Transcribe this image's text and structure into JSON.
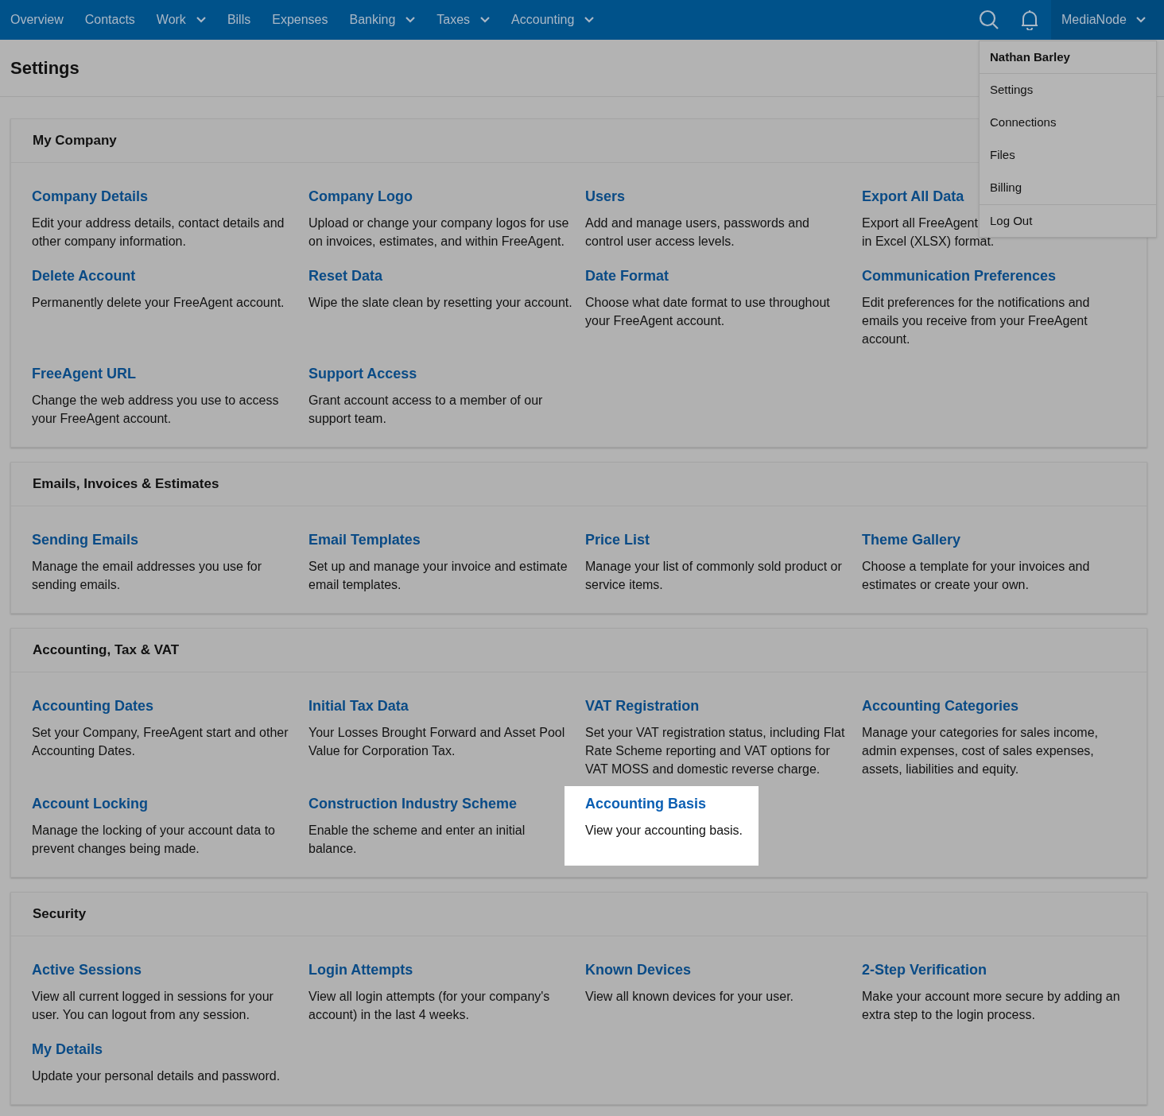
{
  "nav": {
    "items": [
      {
        "label": "Overview",
        "dropdown": false
      },
      {
        "label": "Contacts",
        "dropdown": false
      },
      {
        "label": "Work",
        "dropdown": true
      },
      {
        "label": "Bills",
        "dropdown": false
      },
      {
        "label": "Expenses",
        "dropdown": false
      },
      {
        "label": "Banking",
        "dropdown": true
      },
      {
        "label": "Taxes",
        "dropdown": true
      },
      {
        "label": "Accounting",
        "dropdown": true
      }
    ],
    "account": "MediaNode"
  },
  "user_menu": {
    "name": "Nathan Barley",
    "items": [
      {
        "label": "Settings",
        "divider_before": false
      },
      {
        "label": "Connections",
        "divider_before": false
      },
      {
        "label": "Files",
        "divider_before": false
      },
      {
        "label": "Billing",
        "divider_before": false
      },
      {
        "label": "Log Out",
        "divider_before": true
      }
    ]
  },
  "page_title": "Settings",
  "sections": [
    {
      "title": "My Company",
      "items": [
        {
          "title": "Company Details",
          "description": "Edit your address details, contact details and other company information.",
          "highlighted": false
        },
        {
          "title": "Company Logo",
          "description": "Upload or change your company logos for use on invoices, estimates, and within FreeAgent.",
          "highlighted": false
        },
        {
          "title": "Users",
          "description": "Add and manage users, passwords and control user access levels.",
          "highlighted": false
        },
        {
          "title": "Export All Data",
          "description_lines": [
            "Export all FreeAgent",
            "in Excel (XLSX) format."
          ],
          "highlighted": false
        },
        {
          "title": "Delete Account",
          "description": "Permanently delete your FreeAgent account.",
          "highlighted": false
        },
        {
          "title": "Reset Data",
          "description": "Wipe the slate clean by resetting your account.",
          "highlighted": false
        },
        {
          "title": "Date Format",
          "description": "Choose what date format to use throughout your FreeAgent account.",
          "highlighted": false
        },
        {
          "title": "Communication Preferences",
          "description": "Edit preferences for the notifications and emails you receive from your FreeAgent account.",
          "highlighted": false
        },
        {
          "title": "FreeAgent URL",
          "description": "Change the web address you use to access your FreeAgent account.",
          "highlighted": false
        },
        {
          "title": "Support Access",
          "description": "Grant account access to a member of our support team.",
          "highlighted": false
        }
      ]
    },
    {
      "title": "Emails, Invoices & Estimates",
      "items": [
        {
          "title": "Sending Emails",
          "description": "Manage the email addresses you use for sending emails.",
          "highlighted": false
        },
        {
          "title": "Email Templates",
          "description": "Set up and manage your invoice and estimate email templates.",
          "highlighted": false
        },
        {
          "title": "Price List",
          "description": "Manage your list of commonly sold product or service items.",
          "highlighted": false
        },
        {
          "title": "Theme Gallery",
          "description": "Choose a template for your invoices and estimates or create your own.",
          "highlighted": false
        }
      ]
    },
    {
      "title": "Accounting, Tax & VAT",
      "items": [
        {
          "title": "Accounting Dates",
          "description": "Set your Company, FreeAgent start and other Accounting Dates.",
          "highlighted": false
        },
        {
          "title": "Initial Tax Data",
          "description": "Your Losses Brought Forward and Asset Pool Value for Corporation Tax.",
          "highlighted": false
        },
        {
          "title": "VAT Registration",
          "description": "Set your VAT registration status, including Flat Rate Scheme reporting and VAT options for VAT MOSS and domestic reverse charge.",
          "highlighted": false
        },
        {
          "title": "Accounting Categories",
          "description": "Manage your categories for sales income, admin expenses, cost of sales expenses, assets, liabilities and equity.",
          "highlighted": false
        },
        {
          "title": "Account Locking",
          "description": "Manage the locking of your account data to prevent changes being made.",
          "highlighted": false
        },
        {
          "title": "Construction Industry Scheme",
          "description": "Enable the scheme and enter an initial balance.",
          "highlighted": false
        },
        {
          "title": "Accounting Basis",
          "description": "View your accounting basis.",
          "highlighted": true
        }
      ]
    },
    {
      "title": "Security",
      "items": [
        {
          "title": "Active Sessions",
          "description": "View all current logged in sessions for your user. You can logout from any session.",
          "highlighted": false
        },
        {
          "title": "Login Attempts",
          "description": "View all login attempts (for your company's account) in the last 4 weeks.",
          "highlighted": false
        },
        {
          "title": "Known Devices",
          "description": "View all known devices for your user.",
          "highlighted": false
        },
        {
          "title": "2-Step Verification",
          "description": "Make your account more secure by adding an extra step to the login process.",
          "highlighted": false
        },
        {
          "title": "My Details",
          "description": "Update your personal details and password.",
          "highlighted": false
        }
      ]
    }
  ]
}
